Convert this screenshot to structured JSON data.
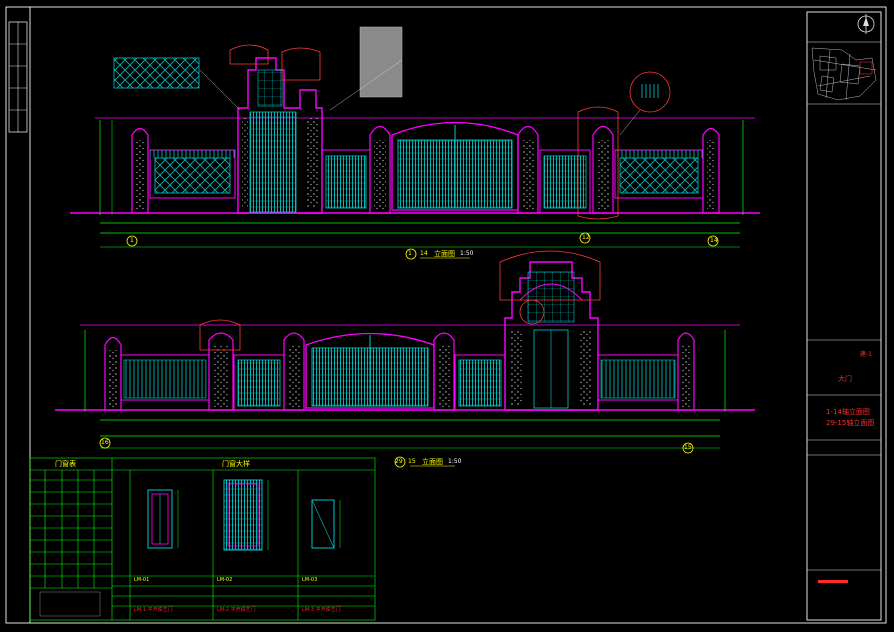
{
  "drawing": {
    "elevation_1": {
      "ref_from": "1",
      "ref_to": "14",
      "label": "立面图",
      "scale": "1:50"
    },
    "elevation_2": {
      "ref_from": "29",
      "ref_to": "15",
      "label": "立面图",
      "scale": "1:50"
    },
    "marker_1": "1",
    "marker_12": "12",
    "marker_14": "14",
    "marker_15": "15",
    "marker_16": "16",
    "marker_29": "29"
  },
  "schedule_table": {
    "title": "门窗表"
  },
  "door_detail": {
    "title": "门窗大样",
    "row1": [
      "LM-01",
      "LM-02",
      "LM-03"
    ],
    "row3": [
      "LM-1 平开铁艺门",
      "LM-2 平开铁艺门",
      "LM-3 平开铁艺门"
    ]
  },
  "title_block": {
    "sheet_tag": "建-1",
    "name": "大门",
    "title_line1": "1-14轴立面图",
    "title_line2": "29-15轴立面图"
  },
  "colors": {
    "background": "#000000",
    "magenta": "#ff00ff",
    "cyan": "#00c8c8",
    "green": "#00ff00",
    "yellow": "#ffff00",
    "red": "#ff0000",
    "white": "#ffffff",
    "gray": "#808080"
  }
}
